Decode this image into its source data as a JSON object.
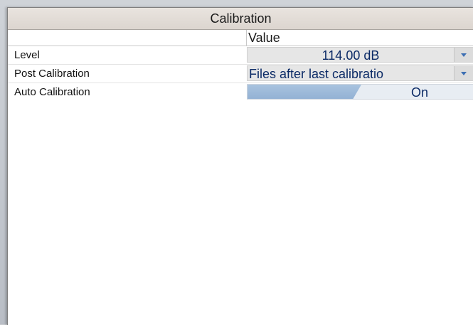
{
  "panel": {
    "title": "Calibration",
    "value_header": "Value"
  },
  "properties": [
    {
      "label": "Level",
      "value": "114.00 dB",
      "control": "dropdown"
    },
    {
      "label": "Post Calibration",
      "value": "Files after last calibratio",
      "control": "dropdown"
    },
    {
      "label": "Auto Calibration",
      "value": "On",
      "control": "toggle"
    }
  ],
  "colors": {
    "title_bg": "#e3ddd7",
    "value_text": "#0b2a66",
    "toggle_fill": "#9db9d9",
    "dropdown_arrow": "#3d6fb3"
  },
  "icons": {
    "dropdown": "chevron-down-icon"
  }
}
